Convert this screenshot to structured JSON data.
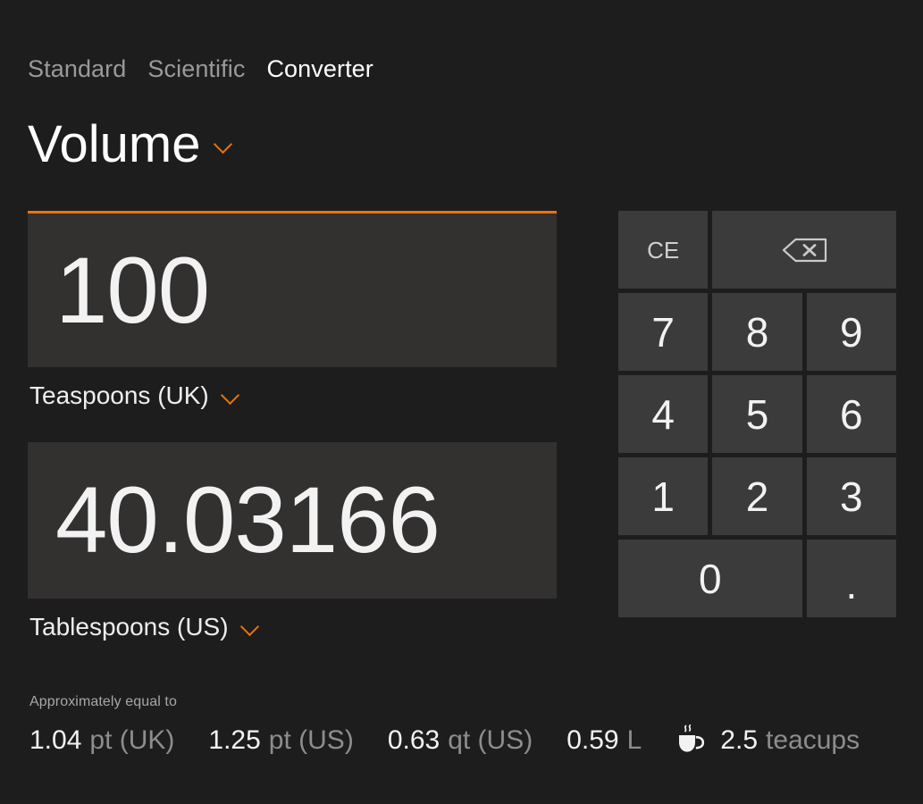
{
  "tabs": [
    {
      "label": "Standard",
      "active": false
    },
    {
      "label": "Scientific",
      "active": false
    },
    {
      "label": "Converter",
      "active": true
    }
  ],
  "category": {
    "title": "Volume",
    "chevron_icon": "chevron-down-icon"
  },
  "converter": {
    "input": {
      "value": "100",
      "unit": "Teaspoons (UK)",
      "unit_chevron_icon": "chevron-down-icon",
      "active": true
    },
    "output": {
      "value": "40.03166",
      "unit": "Tablespoons (US)",
      "unit_chevron_icon": "chevron-down-icon",
      "active": false
    }
  },
  "approximately": {
    "caption": "Approximately equal to",
    "items": [
      {
        "value": "1.04",
        "unit": "pt (UK)",
        "icon": null
      },
      {
        "value": "1.25",
        "unit": "pt (US)",
        "icon": null
      },
      {
        "value": "0.63",
        "unit": "qt (US)",
        "icon": null
      },
      {
        "value": "0.59",
        "unit": "L",
        "icon": null
      },
      {
        "value": "2.5",
        "unit": "teacups",
        "icon": "teacup-icon"
      }
    ]
  },
  "keypad": {
    "clear_entry": "CE",
    "backspace_icon": "backspace-icon",
    "keys": [
      "7",
      "8",
      "9",
      "4",
      "5",
      "6",
      "1",
      "2",
      "3"
    ],
    "zero": "0",
    "decimal": "."
  },
  "colors": {
    "background": "#1d1d1d",
    "accent": "#e8730c",
    "value_box": "#333030",
    "key_background": "#3b3b3b",
    "text_primary": "#f2f2f2",
    "text_muted": "#8d8d8d"
  }
}
